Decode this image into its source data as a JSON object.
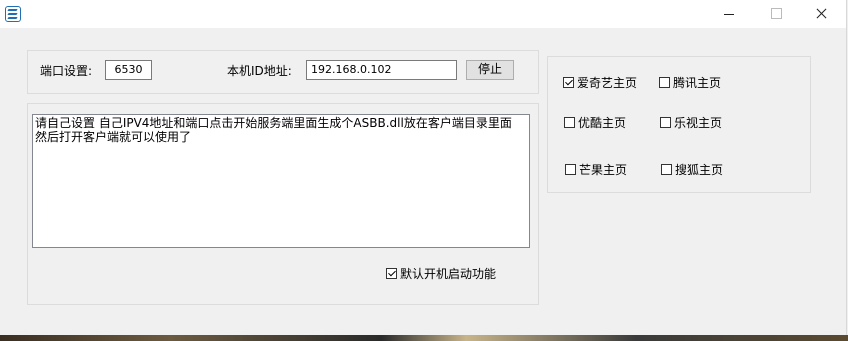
{
  "window": {
    "title": ""
  },
  "settings": {
    "port_label": "端口设置:",
    "port_value": "6530",
    "ip_label": "本机ID地址:",
    "ip_value": "192.168.0.102",
    "stop_button": "停止"
  },
  "log": {
    "text": "请自己设置 自己IPV4地址和端口点击开始服务端里面生成个ASBB.dll放在客户端目录里面 然后打开客户端就可以使用了"
  },
  "autostart": {
    "label": "默认开机启动功能",
    "checked": true
  },
  "homepages": [
    {
      "label": "爱奇艺主页",
      "checked": true
    },
    {
      "label": "腾讯主页",
      "checked": false
    },
    {
      "label": "优酷主页",
      "checked": false
    },
    {
      "label": "乐视主页",
      "checked": false
    },
    {
      "label": "芒果主页",
      "checked": false
    },
    {
      "label": "搜狐主页",
      "checked": false
    }
  ]
}
